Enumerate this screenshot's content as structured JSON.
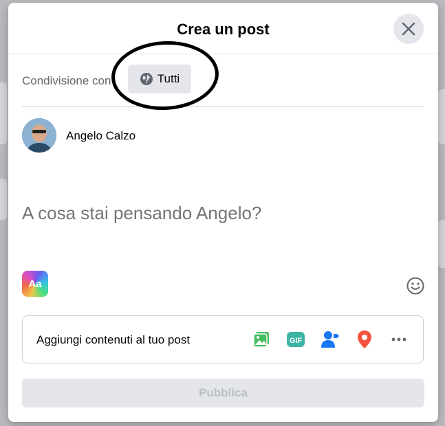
{
  "dialog": {
    "title": "Crea un post"
  },
  "share": {
    "label": "Condivisione con",
    "audience": "Tutti"
  },
  "user": {
    "name": "Angelo Calzo"
  },
  "composer": {
    "placeholder": "A cosa stai pensando Angelo?",
    "text_style_label": "Aa"
  },
  "add_to_post": {
    "label": "Aggiungi contenuti al tuo post",
    "icons": [
      "photo-video-icon",
      "gif-icon",
      "tag-people-icon",
      "location-icon",
      "more-icon"
    ],
    "gif_text": "GIF"
  },
  "actions": {
    "publish_label": "Pubblica"
  },
  "colors": {
    "photo": "#45bd62",
    "gif": "#3bb4a4",
    "tag": "#1877f2",
    "location": "#f5533d",
    "disabled_button": "#e4e6eb"
  }
}
